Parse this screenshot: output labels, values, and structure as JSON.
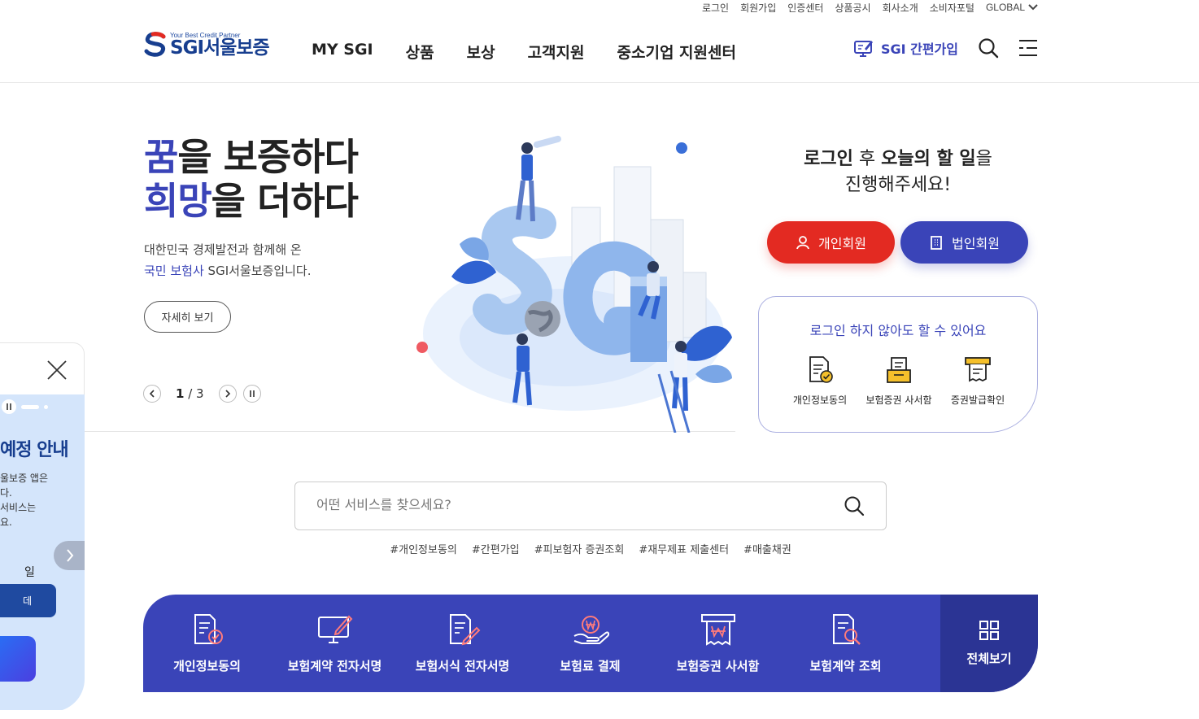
{
  "util_nav": {
    "items": [
      "로그인",
      "회원가입",
      "인증센터",
      "상품공시",
      "회사소개",
      "소비자포털"
    ],
    "global": "GLOBAL"
  },
  "logo": {
    "tagline": "Your Best Credit Partner",
    "name": "SGI서울보증"
  },
  "gnb": [
    "MY SGI",
    "상품",
    "보상",
    "고객지원",
    "중소기업 지원센터"
  ],
  "header_right": {
    "easy_join": "SGI 간편가입"
  },
  "hero": {
    "title_line1_accent": "꿈",
    "title_line1_rest": "을 보증하다",
    "title_line2_accent": "희망",
    "title_line2_rest": "을 더하다",
    "desc_line1": "대한민국 경제발전과 함께해 온",
    "desc_line2_accent": "국민 보험사",
    "desc_line2_rest": " SGI서울보증입니다.",
    "more_button": "자세히 보기",
    "pager_current": "1",
    "pager_total": "/ 3"
  },
  "login_box": {
    "msg_part1": "로그인",
    "msg_part2": " 후 ",
    "msg_part3": "오늘의 할 일",
    "msg_part4": "을",
    "msg_line2": "진행해주세요!",
    "personal_button": "개인회원",
    "corporate_button": "법인회원"
  },
  "no_login": {
    "title": "로그인 하지 않아도 할 수 있어요",
    "items": [
      "개인정보동의",
      "보험증권 사서함",
      "증권발급확인"
    ]
  },
  "search": {
    "placeholder": "어떤 서비스를 찾으세요?",
    "tags": [
      "#개인정보동의",
      "#간편가입",
      "#피보험자 증권조회",
      "#재무제표 제출센터",
      "#매출채권"
    ]
  },
  "quick_menu": {
    "items": [
      "개인정보동의",
      "보험계약 전자서명",
      "보험서식 전자서명",
      "보험료 결제",
      "보험증권 사서함",
      "보험계약 조회"
    ],
    "all_label": "전체보기"
  },
  "popup": {
    "headline": "예정 안내",
    "text_line1": "울보증 앱은",
    "text_line2": "다.",
    "text_line3": " 서비스는",
    "text_line4": "요.",
    "date_text": "일",
    "button1": "데"
  },
  "colors": {
    "brand_blue": "#3a44b8",
    "brand_red": "#e32a22",
    "quick_dark": "#2b3494",
    "popup_bg": "#d4e5fb"
  }
}
